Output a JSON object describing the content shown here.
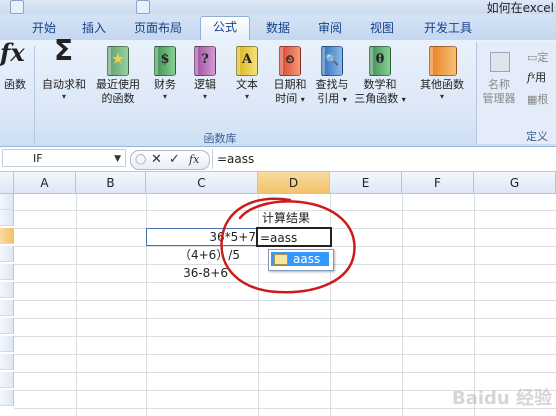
{
  "window": {
    "title": "如何在excel"
  },
  "tabs": [
    "开始",
    "插入",
    "页面布局",
    "公式",
    "数据",
    "审阅",
    "视图",
    "开发工具"
  ],
  "active_tab": "公式",
  "ribbon": {
    "insert_function_label": "函数",
    "autosum": {
      "label": "自动求和",
      "icon": "sigma-icon"
    },
    "recent": {
      "line1": "最近使用",
      "line2": "的函数"
    },
    "finance": "财务",
    "logic": "逻辑",
    "text": "文本",
    "datetime": {
      "line1": "日期和",
      "line2": "时间"
    },
    "lookup": {
      "line1": "查找与",
      "line2": "引用"
    },
    "math": {
      "line1": "数学和",
      "line2": "三角函数"
    },
    "other": "其他函数",
    "name_manager": {
      "line1": "名称",
      "line2": "管理器"
    },
    "right_items": [
      "定",
      "用",
      "根"
    ],
    "group_label": "函数库",
    "right_group_label": "定义",
    "dropdown_arrow": "▾",
    "glyphs": {
      "fx": "fx",
      "sigma": "Σ",
      "recent": "★",
      "finance": "$",
      "logic": "?",
      "text": "A",
      "datetime": "⏲",
      "lookup": "🔍",
      "math": "θ",
      "other": ""
    }
  },
  "formula_bar": {
    "name_box": "IF",
    "name_box_arrow": "▼",
    "cancel": "✕",
    "enter": "✓",
    "fx": "fx",
    "content": "=aass"
  },
  "columns": [
    "A",
    "B",
    "C",
    "D",
    "E",
    "F",
    "G"
  ],
  "selected_column": "D",
  "cells": {
    "d_header": "计算结果",
    "c_row1": "36*5+7",
    "c_row2": "（4+6）/5",
    "c_row3": "36-8+6",
    "d_active": "=aass"
  },
  "autocomplete": {
    "item": "aass",
    "icon": "function-icon"
  },
  "watermark": "Baidu 经验",
  "colors": {
    "accent": "#15428b",
    "selected_header": "#f2c26b",
    "autocomplete_highlight": "#3399ff",
    "annotation": "#cc1b1b"
  }
}
